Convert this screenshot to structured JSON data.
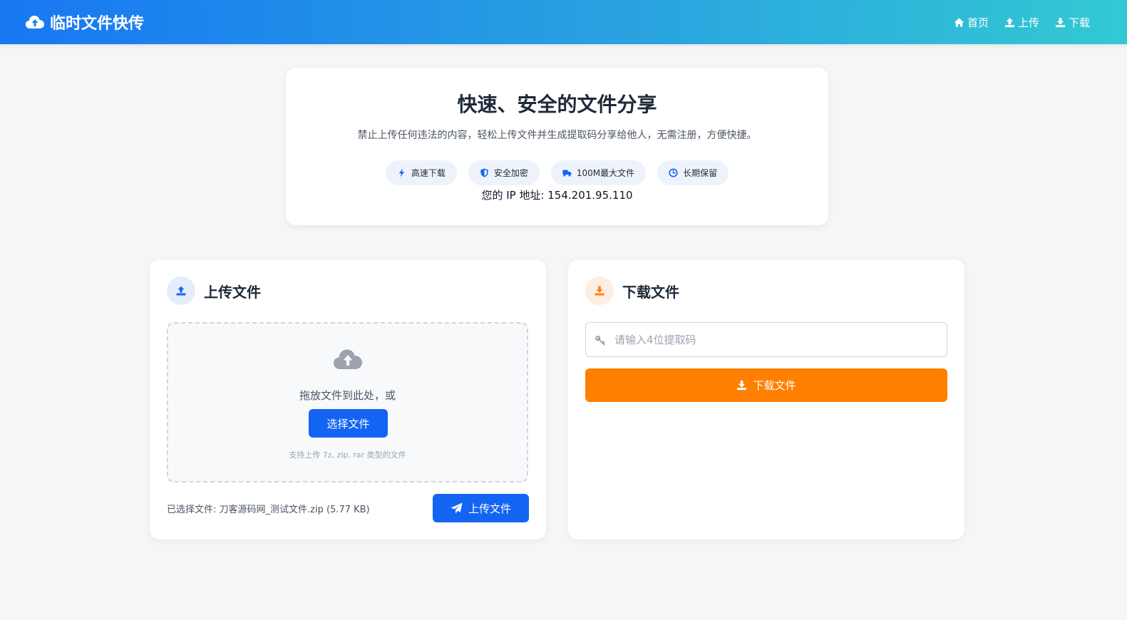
{
  "header": {
    "brand_title": "临时文件快传",
    "brand_icon": "cloud-upload-icon",
    "nav": [
      {
        "label": "首页",
        "icon": "home-icon"
      },
      {
        "label": "上传",
        "icon": "upload-icon"
      },
      {
        "label": "下载",
        "icon": "download-icon"
      }
    ]
  },
  "hero": {
    "title": "快速、安全的文件分享",
    "subtitle": "禁止上传任何违法的内容，轻松上传文件并生成提取码分享给他人，无需注册，方便快捷。",
    "badges": [
      {
        "label": "高速下载",
        "icon": "bolt-icon"
      },
      {
        "label": "安全加密",
        "icon": "shield-icon"
      },
      {
        "label": "100M最大文件",
        "icon": "truck-icon"
      },
      {
        "label": "长期保留",
        "icon": "clock-icon"
      }
    ],
    "ip_text": "您的 IP 地址: 154.201.95.110"
  },
  "upload_card": {
    "title": "上传文件",
    "dropzone_text": "拖放文件到此处，或",
    "choose_button": "选择文件",
    "hint": "支持上传 7z, zip, rar 类型的文件",
    "selected_file": "已选择文件: 刀客源码网_测试文件.zip (5.77 KB)",
    "upload_button": "上传文件"
  },
  "download_card": {
    "title": "下载文件",
    "code_placeholder": "请输入4位提取码",
    "code_value": "",
    "download_button": "下载文件"
  },
  "colors": {
    "primary": "#1464f4",
    "accent_orange": "#ff7f00",
    "header_gradient_start": "#1877f2",
    "header_gradient_end": "#33c9d3"
  }
}
